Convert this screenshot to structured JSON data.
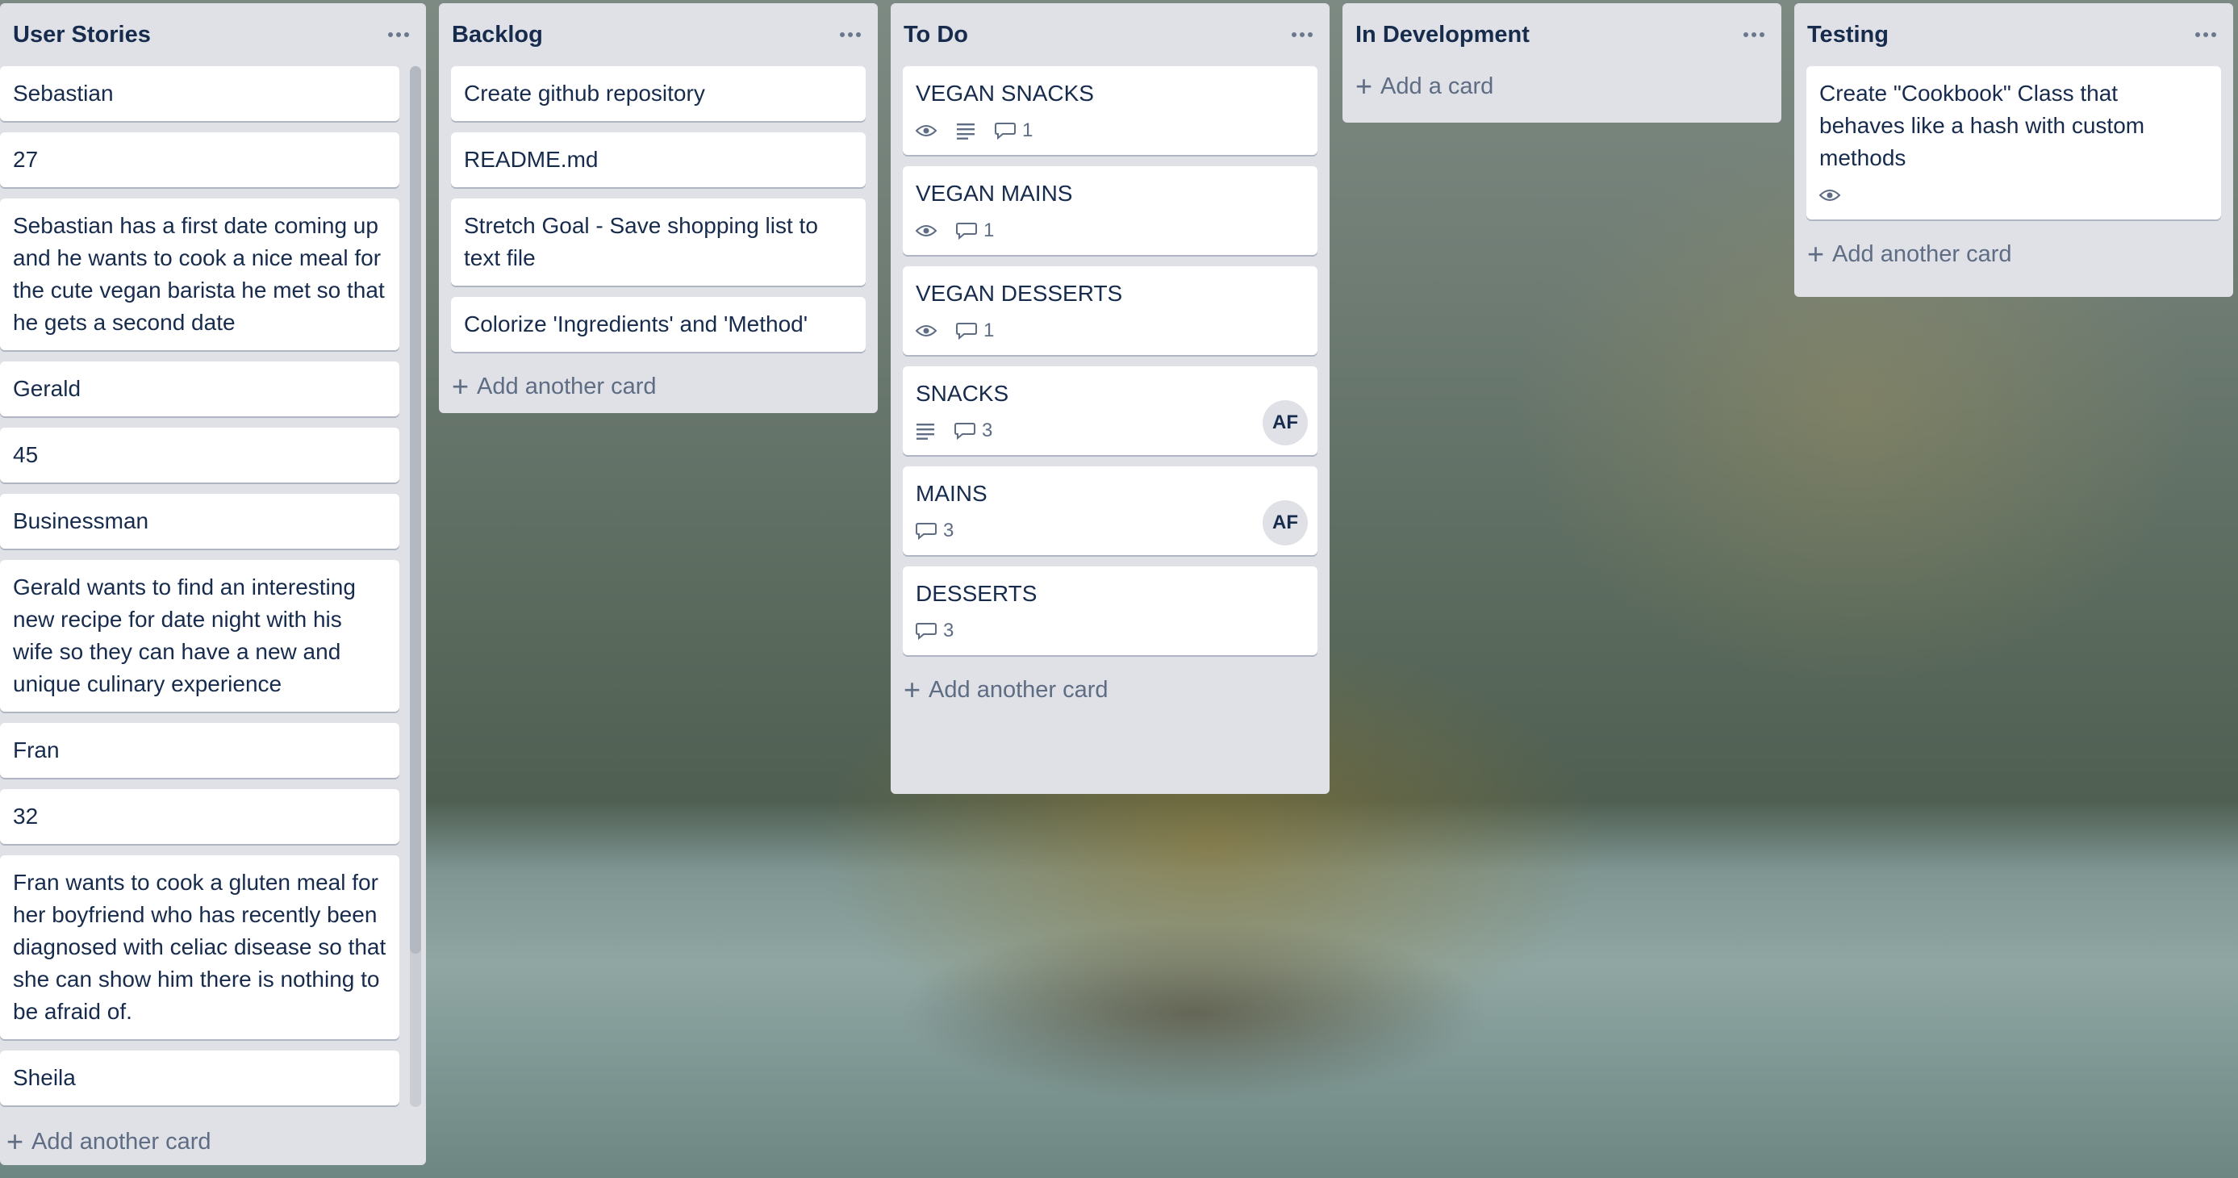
{
  "lists": [
    {
      "title": "User Stories",
      "cards": [
        {
          "text": "Sebastian"
        },
        {
          "text": "27"
        },
        {
          "text": "Sebastian has a first date coming up and he wants to cook a nice meal for the cute vegan barista he met so that he gets a second date"
        },
        {
          "text": "Gerald"
        },
        {
          "text": "45"
        },
        {
          "text": "Businessman"
        },
        {
          "text": "Gerald wants to find an interesting new recipe for date night with his wife so they can have a new and unique culinary experience"
        },
        {
          "text": "Fran"
        },
        {
          "text": "32"
        },
        {
          "text": "Fran wants to cook a gluten meal for her boyfriend who has recently been diagnosed with celiac disease so that she can show him there is nothing to be afraid of."
        },
        {
          "text": "Sheila"
        }
      ],
      "add_label": "Add another card"
    },
    {
      "title": "Backlog",
      "cards": [
        {
          "text": "Create github repository"
        },
        {
          "text": "README.md"
        },
        {
          "text": "Stretch Goal - Save shopping list to text file"
        },
        {
          "text": "Colorize 'Ingredients' and 'Method'"
        }
      ],
      "add_label": "Add another card"
    },
    {
      "title": "To Do",
      "cards": [
        {
          "text": "VEGAN SNACKS",
          "watch": true,
          "description": true,
          "comments": "1"
        },
        {
          "text": "VEGAN MAINS",
          "watch": true,
          "comments": "1"
        },
        {
          "text": "VEGAN DESSERTS",
          "watch": true,
          "comments": "1"
        },
        {
          "text": "SNACKS",
          "description": true,
          "comments": "3",
          "member": "AF"
        },
        {
          "text": "MAINS",
          "comments": "3",
          "member": "AF"
        },
        {
          "text": "DESSERTS",
          "comments": "3"
        }
      ],
      "add_label": "Add another card"
    },
    {
      "title": "In Development",
      "cards": [],
      "add_label": "Add a card"
    },
    {
      "title": "Testing",
      "cards": [
        {
          "text": "Create \"Cookbook\" Class that behaves like a hash with custom methods",
          "watch": true
        }
      ],
      "add_label": "Add another card"
    }
  ],
  "icons": {
    "menu": "more-horizontal-icon",
    "watch": "eye-icon",
    "description": "description-icon",
    "comments": "comment-icon",
    "add": "plus-icon"
  },
  "colors": {
    "list_bg": "#dfe1e6",
    "card_bg": "#ffffff",
    "text": "#172b4d",
    "muted": "#5e6c84"
  }
}
